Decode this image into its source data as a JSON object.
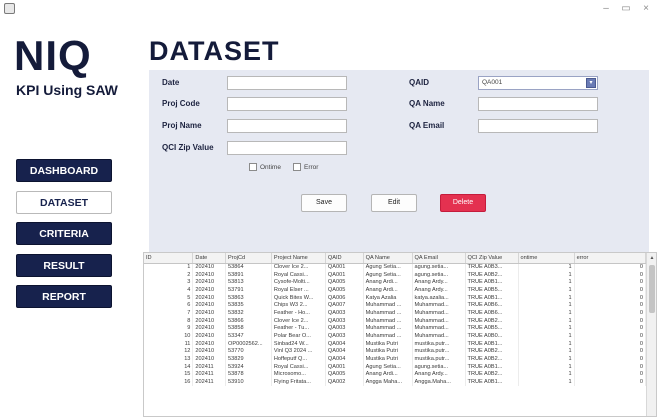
{
  "window": {
    "minimize_glyph": "–",
    "maximize_glyph": "▭",
    "close_glyph": "×"
  },
  "sidebar": {
    "logo": "NIQ",
    "subtitle": "KPI Using SAW",
    "nav": [
      {
        "label": "DASHBOARD",
        "active": false
      },
      {
        "label": "DATASET",
        "active": true
      },
      {
        "label": "CRITERIA",
        "active": false
      },
      {
        "label": "RESULT",
        "active": false
      },
      {
        "label": "REPORT",
        "active": false
      }
    ]
  },
  "page": {
    "title": "DATASET"
  },
  "form": {
    "date_label": "Date",
    "proj_code_label": "Proj Code",
    "proj_name_label": "Proj Name",
    "qci_zip_label": "QCI Zip Value",
    "qaid_label": "QAID",
    "qa_name_label": "QA Name",
    "qa_email_label": "QA Email",
    "qaid_selected": "QA001",
    "ontime_label": "Ontime",
    "error_label": "Error",
    "save_label": "Save",
    "edit_label": "Edit",
    "delete_label": "Delete"
  },
  "table": {
    "columns": [
      "ID",
      "Date",
      "ProjCd",
      "Project Name",
      "QAID",
      "QA Name",
      "QA Email",
      "QCI Zip Value",
      "ontime",
      "error"
    ],
    "rows": [
      [
        "1",
        "202410",
        "53864",
        "Clover Ice 2...",
        "QA001",
        "Agung Setia...",
        "agung.setia...",
        "TRUE A0B3...",
        "1",
        "0"
      ],
      [
        "2",
        "202410",
        "53891",
        "Royal Cassi...",
        "QA001",
        "Agung Setia...",
        "agung.setia...",
        "TRUE A0B2...",
        "1",
        "0"
      ],
      [
        "3",
        "202410",
        "53813",
        "Cysofe-Molti...",
        "QA005",
        "Anang Ardi...",
        "Anang Ardy...",
        "TRUE A0B1...",
        "1",
        "0"
      ],
      [
        "4",
        "202410",
        "53791",
        "Royal Elser ...",
        "QA005",
        "Anang Ardi...",
        "Anang Ardy...",
        "TRUE A0B5...",
        "1",
        "0"
      ],
      [
        "5",
        "202410",
        "53863",
        "Quick Bites W...",
        "QA006",
        "Katya Azalia",
        "katya.azalia...",
        "TRUE A0B1...",
        "1",
        "0"
      ],
      [
        "6",
        "202410",
        "53835",
        "Chips W3 2...",
        "QA007",
        "Muhammad ...",
        "Muhammad...",
        "TRUE A0B6...",
        "1",
        "0"
      ],
      [
        "7",
        "202410",
        "53832",
        "Feather - Ho...",
        "QA003",
        "Muhammad ...",
        "Muhammad...",
        "TRUE A0B6...",
        "1",
        "0"
      ],
      [
        "8",
        "202410",
        "53866",
        "Clover Ice 2...",
        "QA003",
        "Muhammad ...",
        "Muhammad...",
        "TRUE A0B2...",
        "1",
        "0"
      ],
      [
        "9",
        "202410",
        "53858",
        "Feather - Tu...",
        "QA003",
        "Muhammad ...",
        "Muhammad...",
        "TRUE A0B5...",
        "1",
        "0"
      ],
      [
        "10",
        "202410",
        "53347",
        "Polar Bear O...",
        "QA003",
        "Muhammad ...",
        "Muhammad...",
        "TRUE A0B0...",
        "1",
        "0"
      ],
      [
        "11",
        "202410",
        "OP0002562...",
        "Sinbad24 W...",
        "QA004",
        "Mustika Putri",
        "mustika.putr...",
        "TRUE A0B1...",
        "1",
        "0"
      ],
      [
        "12",
        "202410",
        "53770",
        "Vinl Q3 2024 ...",
        "QA004",
        "Mustika Putri",
        "mustika.putr...",
        "TRUE A0B2...",
        "1",
        "0"
      ],
      [
        "13",
        "202410",
        "53829",
        "Hoffeputf Q...",
        "QA004",
        "Mustika Putri",
        "mustika.putr...",
        "TRUE A0B2...",
        "1",
        "0"
      ],
      [
        "14",
        "202411",
        "53924",
        "Royal Cassi...",
        "QA001",
        "Agung Setia...",
        "agung.setia...",
        "TRUE A0B1...",
        "1",
        "0"
      ],
      [
        "15",
        "202411",
        "53878",
        "Microsomo...",
        "QA005",
        "Anang Ardi...",
        "Anang Ardy...",
        "TRUE A0B2...",
        "1",
        "0"
      ],
      [
        "16",
        "202411",
        "53910",
        "Flying Fritata...",
        "QA002",
        "Angga Maha...",
        "Angga.Maha...",
        "TRUE A0B1...",
        "1",
        "0"
      ]
    ]
  },
  "colors": {
    "navy": "#17224d",
    "panel": "#e6e9f2",
    "delete_red": "#e43150"
  }
}
